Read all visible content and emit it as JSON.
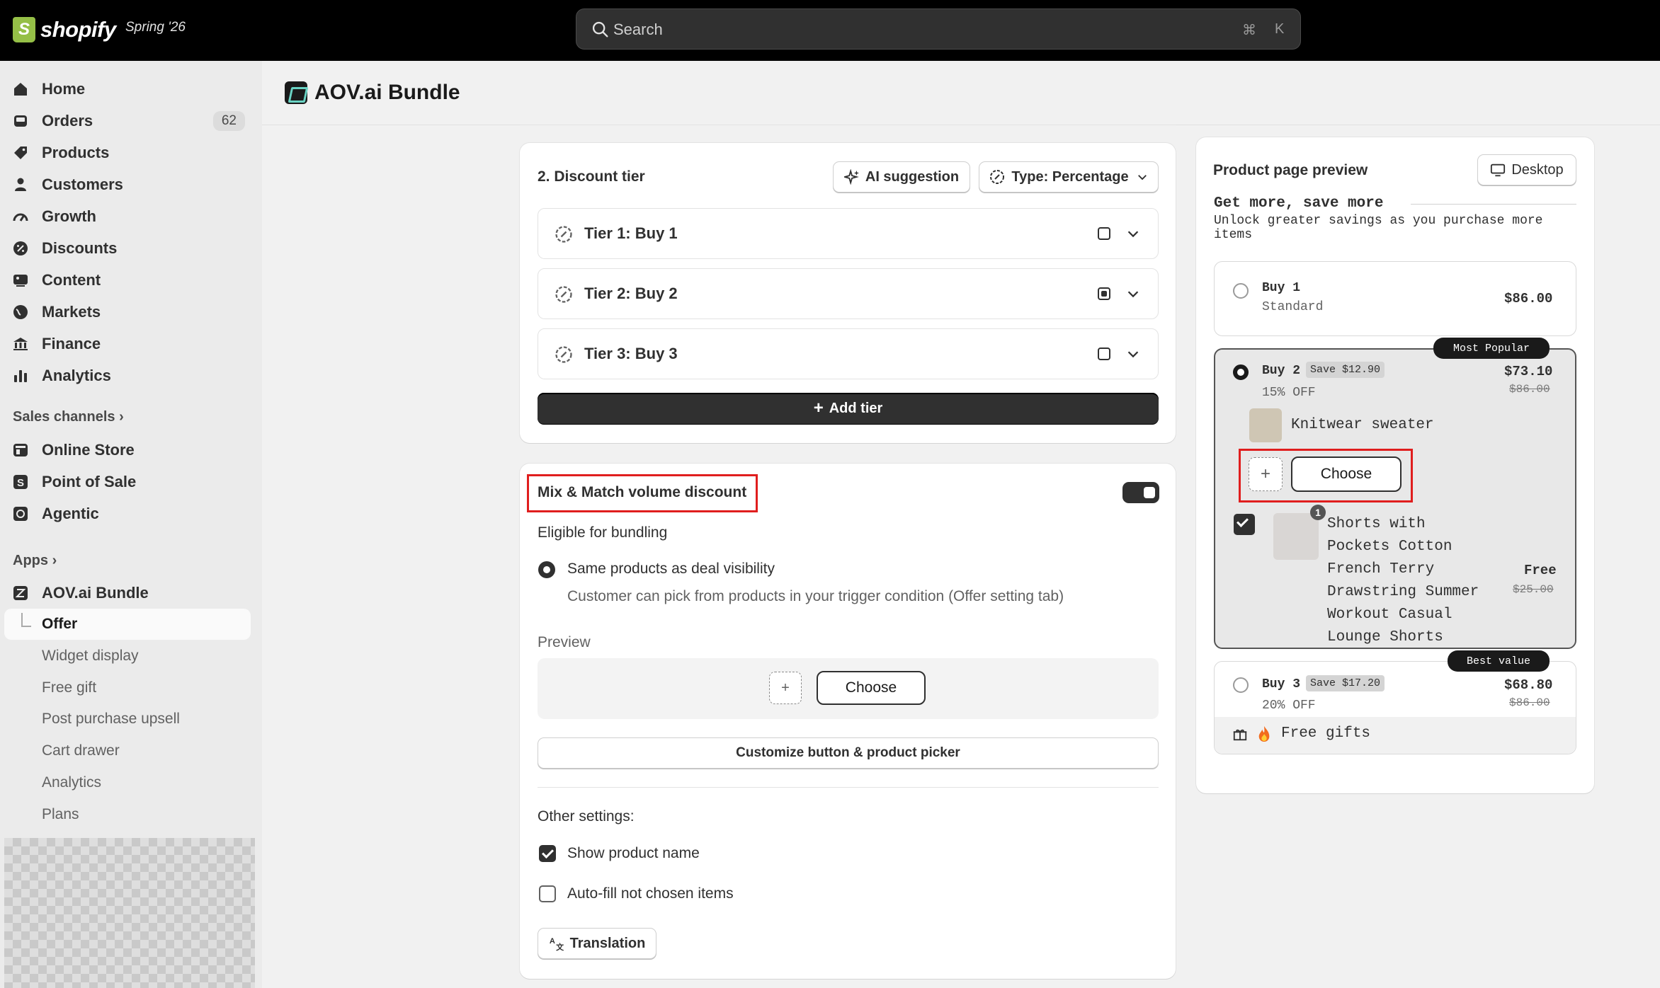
{
  "topbar": {
    "brand": "shopify",
    "edition": "Spring '26",
    "search_placeholder": "Search",
    "shortcut_cmd": "⌘",
    "shortcut_key": "K"
  },
  "sidebar": {
    "items": [
      {
        "label": "Home",
        "icon": "home-icon"
      },
      {
        "label": "Orders",
        "icon": "inbox-icon",
        "badge": "62"
      },
      {
        "label": "Products",
        "icon": "tag-icon"
      },
      {
        "label": "Customers",
        "icon": "person-icon"
      },
      {
        "label": "Growth",
        "icon": "gauge-icon"
      },
      {
        "label": "Discounts",
        "icon": "discount-icon"
      },
      {
        "label": "Content",
        "icon": "image-icon"
      },
      {
        "label": "Markets",
        "icon": "globe-icon"
      },
      {
        "label": "Finance",
        "icon": "bank-icon"
      },
      {
        "label": "Analytics",
        "icon": "bar-chart-icon"
      }
    ],
    "sales_channels_label": "Sales channels",
    "sales_channels": [
      {
        "label": "Online Store",
        "icon": "store-icon"
      },
      {
        "label": "Point of Sale",
        "icon": "pos-icon"
      },
      {
        "label": "Agentic",
        "icon": "agentic-icon"
      }
    ],
    "apps_label": "Apps",
    "app_name": "AOV.ai Bundle",
    "app_sub": [
      "Offer",
      "Widget display",
      "Free gift",
      "Post purchase upsell",
      "Cart drawer",
      "Analytics",
      "Plans"
    ]
  },
  "page": {
    "title": "AOV.ai Bundle"
  },
  "discount_tier": {
    "title": "2. Discount tier",
    "ai_suggestion": "AI suggestion",
    "type": "Type: Percentage",
    "tiers": [
      "Tier 1: Buy 1",
      "Tier 2: Buy 2",
      "Tier 3: Buy 3"
    ],
    "add_tier": "Add tier"
  },
  "mix_match": {
    "title": "Mix & Match volume discount",
    "eligible_label": "Eligible for bundling",
    "option_label": "Same products as deal visibility",
    "option_help": "Customer can pick from products in your trigger condition (Offer setting tab)",
    "preview_label": "Preview",
    "plus": "+",
    "choose": "Choose",
    "customize": "Customize button & product picker",
    "other_settings": "Other settings:",
    "show_product_name": "Show product name",
    "autofill": "Auto-fill not chosen items",
    "translation": "Translation"
  },
  "preview": {
    "title": "Product page preview",
    "device": "Desktop",
    "heading": "Get more, save more",
    "subheading": "Unlock greater savings as you purchase more items",
    "option1": {
      "title": "Buy 1",
      "sub": "Standard",
      "price": "$86.00"
    },
    "option2": {
      "badge": "Most Popular",
      "title": "Buy 2",
      "save": "Save $12.90",
      "sub": "15% OFF",
      "price": "$73.10",
      "compare": "$86.00",
      "item1": "Knitwear sweater",
      "plus": "+",
      "choose": "Choose",
      "item2_count": "1",
      "item2_lines": [
        "Shorts with",
        "Pockets Cotton",
        "French Terry",
        "Drawstring Summer",
        "Workout Casual",
        "Lounge Shorts"
      ],
      "item2_price": "Free",
      "item2_compare": "$25.00"
    },
    "option3": {
      "badge": "Best value",
      "title": "Buy 3",
      "save": "Save $17.20",
      "sub": "20% OFF",
      "price": "$68.80",
      "compare": "$86.00",
      "gift": "Free gifts"
    }
  },
  "colors": {
    "topbar": "#000000",
    "sidebar": "#ebebeb",
    "highlight": "#e01e1e",
    "primary_dark": "#303030"
  }
}
